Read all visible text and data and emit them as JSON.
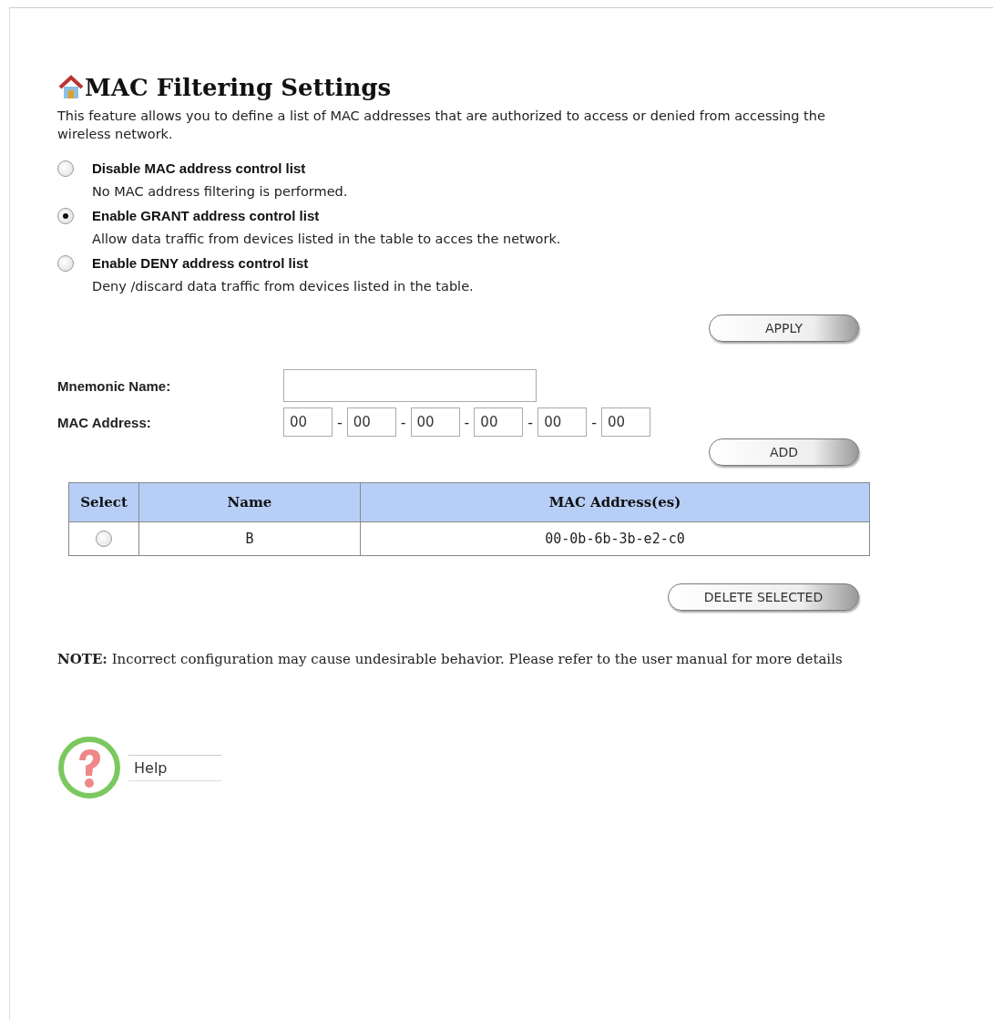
{
  "page": {
    "title": "MAC Filtering Settings",
    "description": "This feature allows you to define a list of MAC addresses that are authorized to access or denied from accessing the wireless network."
  },
  "modes": [
    {
      "label": "Disable MAC address control list",
      "description": "No MAC address filtering is performed.",
      "selected": false
    },
    {
      "label": "Enable GRANT address control list",
      "description": "Allow data traffic from devices listed in the table to acces the network.",
      "selected": true
    },
    {
      "label": "Enable DENY address control list",
      "description": "Deny /discard data traffic from devices listed in the table.",
      "selected": false
    }
  ],
  "apply_button": "APPLY",
  "form": {
    "name_label": "Mnemonic Name:",
    "mac_label": "MAC Address:",
    "mac_octets": [
      "00",
      "00",
      "00",
      "00",
      "00",
      "00"
    ],
    "separators": [
      "-",
      "-",
      "-",
      "-",
      "-"
    ]
  },
  "add_button": "ADD",
  "table": {
    "columns": [
      "Select",
      "Name",
      "MAC Address(es)"
    ],
    "rows": [
      {
        "selected": false,
        "name": "B",
        "mac": "00-0b-6b-3b-e2-c0"
      }
    ]
  },
  "delete_button": "DELETE SELECTED",
  "note": "**NOTE:** Incorrect configuration may cause undesirable behavior. Please refer to the user manual for more details",
  "help": {
    "label": "Help"
  }
}
